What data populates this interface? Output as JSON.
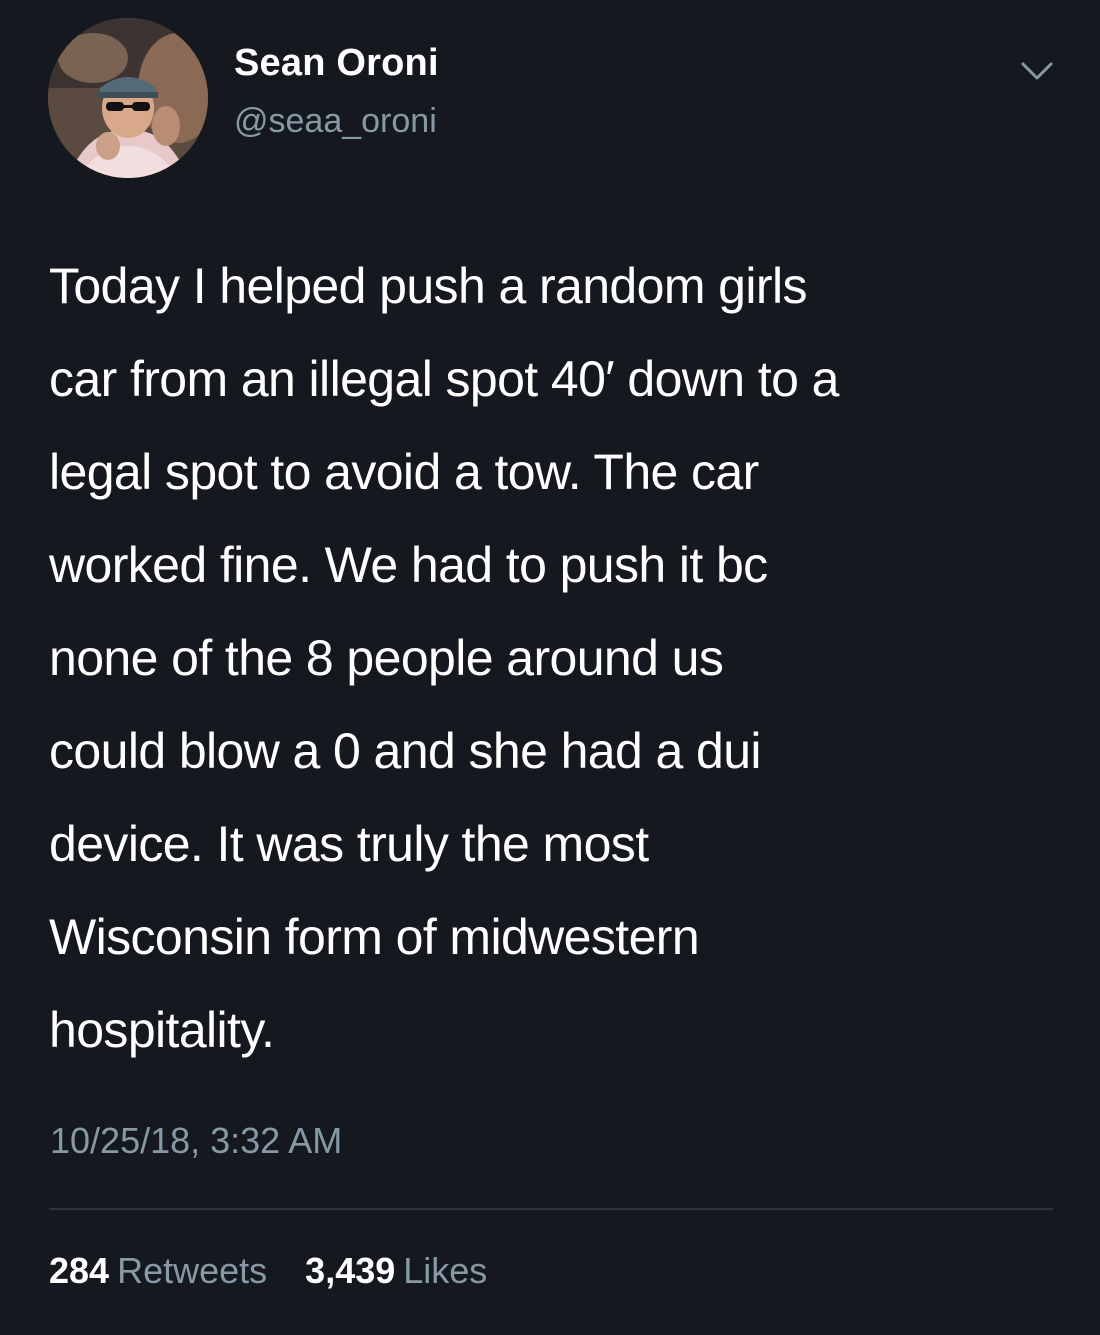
{
  "author": {
    "display_name": "Sean Oroni",
    "handle": "@seaa_oroni",
    "avatar_icon": "profile-photo"
  },
  "menu_icon": "chevron-down-icon",
  "tweet": {
    "text": "Today I helped push a random girls\ncar from an illegal spot 40′ down to a\nlegal spot to avoid a tow. The car\nworked fine. We had to push it bc\nnone of the 8 people around us\ncould blow a 0 and she had a dui\ndevice. It was truly the most\nWisconsin form of midwestern\nhospitality.",
    "timestamp": "10/25/18, 3:32 AM"
  },
  "stats": {
    "retweets_count": "284",
    "retweets_label": "Retweets",
    "likes_count": "3,439",
    "likes_label": "Likes"
  },
  "colors": {
    "background": "#15181f",
    "primary_text": "#ffffff",
    "secondary_text": "#8899a6",
    "divider": "#2b333c"
  }
}
